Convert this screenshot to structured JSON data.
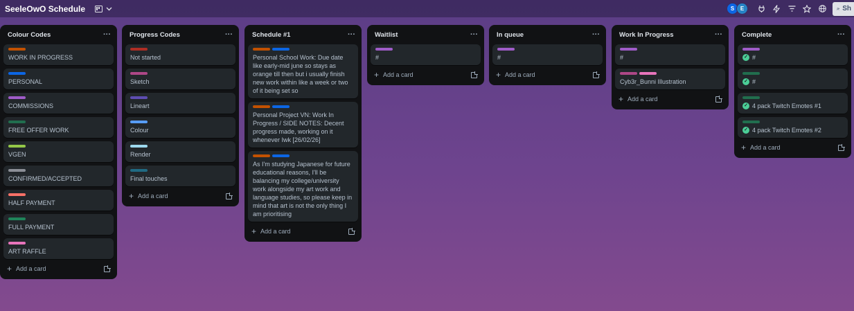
{
  "board": {
    "title": "SeeleOwO Schedule"
  },
  "topbar": {
    "avatars": [
      "S",
      "E"
    ],
    "share_label": "Sh"
  },
  "add_card_label": "Add a card",
  "colors": {
    "orange": "#c25100",
    "blue": "#0c66e4",
    "purple": "#9f5cc8",
    "green": "#216e4e",
    "lime": "#94c748",
    "gray": "#8c8f97",
    "red": "#f87168",
    "dark_red": "#ae2e24",
    "pink": "#e774bb",
    "magenta": "#ae4787",
    "dark_purple": "#5e4db2",
    "sky": "#579dff",
    "light_sky": "#9dd9ee",
    "teal": "#206a83",
    "dark_green": "#1f845a"
  },
  "lists": [
    {
      "title": "Colour Codes",
      "cards": [
        {
          "labels": [
            "#c25100"
          ],
          "title": "WORK IN PROGRESS"
        },
        {
          "labels": [
            "#0c66e4"
          ],
          "title": "PERSONAL"
        },
        {
          "labels": [
            "#9f5cc8"
          ],
          "title": "COMMISSIONS"
        },
        {
          "labels": [
            "#216e4e"
          ],
          "title": "FREE OFFER WORK"
        },
        {
          "labels": [
            "#94c748"
          ],
          "title": "VGEN"
        },
        {
          "labels": [
            "#8c8f97"
          ],
          "title": "CONFIRMED/ACCEPTED"
        },
        {
          "labels": [
            "#f87168"
          ],
          "title": "HALF PAYMENT"
        },
        {
          "labels": [
            "#1f845a"
          ],
          "title": "FULL PAYMENT"
        },
        {
          "labels": [
            "#e774bb"
          ],
          "title": "ART RAFFLE"
        }
      ]
    },
    {
      "title": "Progress Codes",
      "cards": [
        {
          "labels": [
            "#ae2e24"
          ],
          "title": "Not started"
        },
        {
          "labels": [
            "#ae4787"
          ],
          "title": "Sketch"
        },
        {
          "labels": [
            "#5e4db2"
          ],
          "title": "Lineart"
        },
        {
          "labels": [
            "#579dff"
          ],
          "title": "Colour"
        },
        {
          "labels": [
            "#9dd9ee"
          ],
          "title": "Render"
        },
        {
          "labels": [
            "#206a83"
          ],
          "title": "Final touches"
        }
      ]
    },
    {
      "title": "Schedule #1",
      "cards": [
        {
          "labels": [
            "#c25100",
            "#0c66e4"
          ],
          "title": "Personal School Work: Due date like early-mid june so stays as orange till then but i usually finish new work within like a week or two of it being set so"
        },
        {
          "labels": [
            "#c25100",
            "#0c66e4"
          ],
          "title": "Personal Project VN: Work In Progress / SIDE NOTES: Decent progress made, working on it whenever Iwk [26/02/26]"
        },
        {
          "labels": [
            "#c25100",
            "#0c66e4"
          ],
          "title": "As I'm studying Japanese for future educational reasons, I'll be balancing my college/university work alongside my art work and language studies, so please keep in mind that art is not the only thing I am prioritising"
        }
      ]
    },
    {
      "title": "Waitlist",
      "cards": [
        {
          "labels": [
            "#9f5cc8"
          ],
          "title": "#"
        }
      ]
    },
    {
      "title": "In queue",
      "cards": [
        {
          "labels": [
            "#9f5cc8"
          ],
          "title": "#"
        }
      ]
    },
    {
      "title": "Work In Progress",
      "cards": [
        {
          "labels": [
            "#9f5cc8"
          ],
          "title": "#"
        },
        {
          "labels": [
            "#ae4787",
            "#e774bb"
          ],
          "title": "Cyb3r_Bunni Illustration"
        }
      ]
    },
    {
      "title": "Complete",
      "cards": [
        {
          "labels": [
            "#9f5cc8"
          ],
          "title": "#",
          "done": true
        },
        {
          "labels": [
            "#216e4e"
          ],
          "title": "#",
          "done": true
        },
        {
          "labels": [
            "#216e4e"
          ],
          "title": "4 pack Twitch Emotes #1",
          "done": true
        },
        {
          "labels": [
            "#216e4e"
          ],
          "title": "4 pack Twitch Emotes #2",
          "done": true
        }
      ]
    }
  ]
}
